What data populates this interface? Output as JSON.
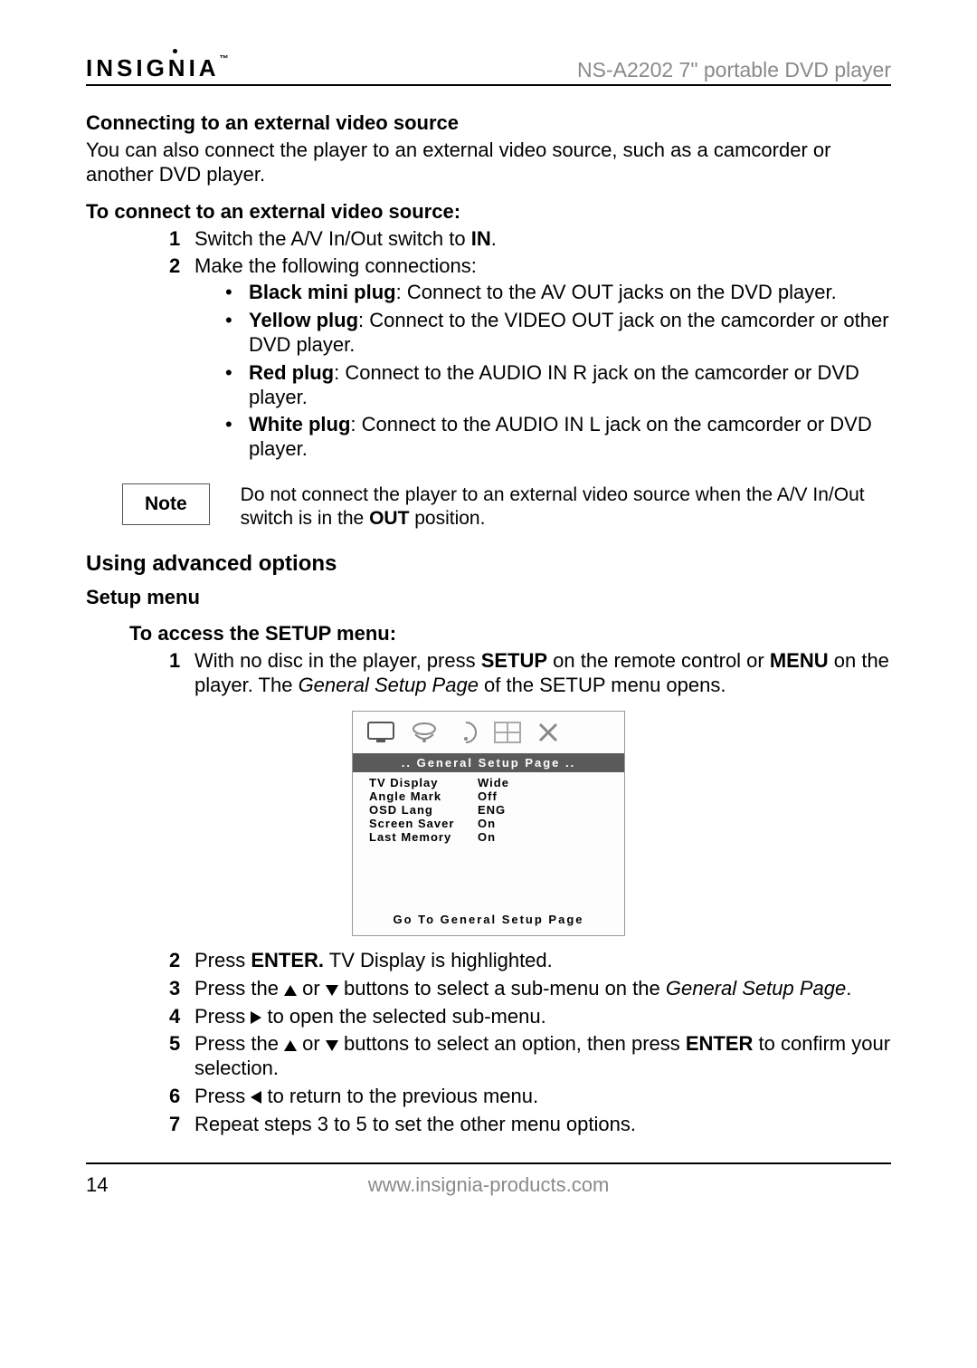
{
  "header": {
    "brand": "INSIGNIA",
    "brand_tm": "™",
    "model": "NS-A2202 7\" portable DVD player"
  },
  "sec1": {
    "title": "Connecting to an external video source",
    "para": "You can also connect the player to an external video source, such as a camcorder or another DVD player."
  },
  "sec1steps": {
    "heading": "To connect to an external video source:",
    "s1_pre": "Switch the A/V In/Out switch to ",
    "s1_bold": "IN",
    "s1_post": ".",
    "s2": "Make the following connections:",
    "b1_label": "Black mini plug",
    "b1_text": ": Connect to the AV OUT jacks on the DVD player.",
    "b2_label": "Yellow plug",
    "b2_text": ": Connect to the VIDEO OUT jack on the camcorder or other DVD player.",
    "b3_label": "Red plug",
    "b3_text": ": Connect to the AUDIO IN R jack on the camcorder or DVD player.",
    "b4_label": "White plug",
    "b4_text": ": Connect to the AUDIO IN L jack on the camcorder or DVD player."
  },
  "note": {
    "label": "Note",
    "pre": "Do not connect the player to an external video source when the A/V In/Out switch is in the ",
    "bold": "OUT",
    "post": " position."
  },
  "sec2": {
    "title": "Using advanced options",
    "sub": "Setup menu",
    "heading": "To access the SETUP menu:",
    "s1_pre": "With no disc in the player, press ",
    "s1_b1": "SETUP",
    "s1_mid": " on the remote control or ",
    "s1_b2": "MENU",
    "s1_mid2": " on the player. The ",
    "s1_ital": "General Setup Page",
    "s1_post": " of the SETUP menu opens.",
    "s2_pre": "Press ",
    "s2_b": "ENTER.",
    "s2_post": " TV Display is highlighted.",
    "s3_pre": "Press the ",
    "s3_mid": " or ",
    "s3_post1": " buttons to select a sub-menu on the ",
    "s3_ital": "General Setup Page",
    "s3_post2": ".",
    "s4_pre": "Press ",
    "s4_post": " to open the selected sub-menu.",
    "s5_pre": "Press the ",
    "s5_mid": " or ",
    "s5_post1": " buttons to select an option, then press ",
    "s5_b": "ENTER",
    "s5_post2": " to confirm your selection.",
    "s6_pre": "Press ",
    "s6_post": " to return to the previous menu.",
    "s7": "Repeat steps 3 to 5 to set the other menu options."
  },
  "setup_screen": {
    "title": "..  General  Setup  Page  ..",
    "rows": [
      {
        "label": "TV   Display",
        "value": "Wide"
      },
      {
        "label": "Angle  Mark",
        "value": "Off"
      },
      {
        "label": "OSD  Lang",
        "value": "ENG"
      },
      {
        "label": "Screen  Saver",
        "value": "On"
      },
      {
        "label": "Last  Memory",
        "value": "On"
      }
    ],
    "footer": "Go  To   General  Setup  Page"
  },
  "footer": {
    "page": "14",
    "url": "www.insignia-products.com"
  }
}
